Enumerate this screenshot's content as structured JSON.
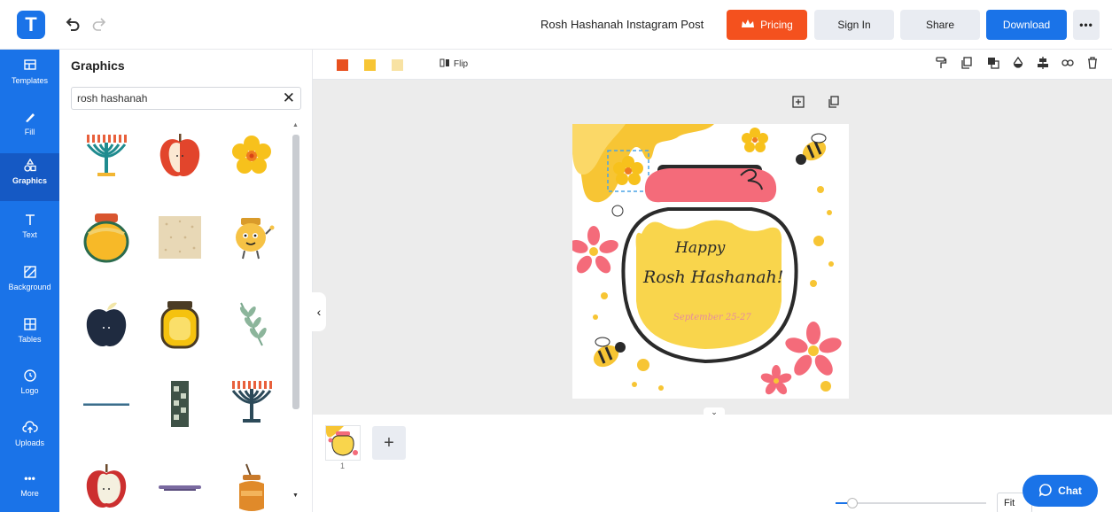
{
  "app": {
    "logo_letter": "T",
    "doc_title": "Rosh Hashanah Instagram Post",
    "colors": {
      "brand": "#1a73e8",
      "pricing": "#f4511e",
      "rail_active": "#1559c4"
    }
  },
  "topbar": {
    "pricing_label": "Pricing",
    "signin_label": "Sign In",
    "share_label": "Share",
    "download_label": "Download",
    "more_label": "•••"
  },
  "rail": {
    "items": [
      {
        "label": "Templates",
        "icon": "templates-icon"
      },
      {
        "label": "Fill",
        "icon": "brush-icon"
      },
      {
        "label": "Graphics",
        "icon": "shapes-icon",
        "active": true
      },
      {
        "label": "Text",
        "icon": "text-icon"
      },
      {
        "label": "Background",
        "icon": "background-icon"
      },
      {
        "label": "Tables",
        "icon": "table-icon"
      },
      {
        "label": "Logo",
        "icon": "logo-icon"
      },
      {
        "label": "Uploads",
        "icon": "cloud-upload-icon"
      },
      {
        "label": "More",
        "icon": "more-icon"
      }
    ]
  },
  "graphics_panel": {
    "title": "Graphics",
    "search_value": "rosh hashanah",
    "clear_label": "✕",
    "results": [
      "menorah",
      "apple",
      "yellow flower",
      "honey jar",
      "matzah texture",
      "honey pot character",
      "dark apple",
      "honey jar golden",
      "green branch",
      "divider line",
      "green pattern strip",
      "menorah",
      "apple half",
      "tray",
      "honey pot"
    ]
  },
  "workspace": {
    "swatches": [
      "#e8501e",
      "#f7c534",
      "#f8e2a3"
    ],
    "flip_label": "Flip",
    "tools": [
      "paint-roller-icon",
      "duplicate-icon",
      "layer-icon",
      "opacity-icon",
      "align-icon",
      "link-icon",
      "trash-icon"
    ],
    "canvas_tools": [
      "add-page-icon",
      "copy-page-icon"
    ],
    "design": {
      "line1": "Happy",
      "line2": "Rosh Hashanah!",
      "line3": "September 25-27"
    }
  },
  "pages": {
    "current_page": "1",
    "add_label": "+",
    "fit_label": "Fit",
    "zoom_level": 0.1
  },
  "chat": {
    "label": "Chat"
  }
}
